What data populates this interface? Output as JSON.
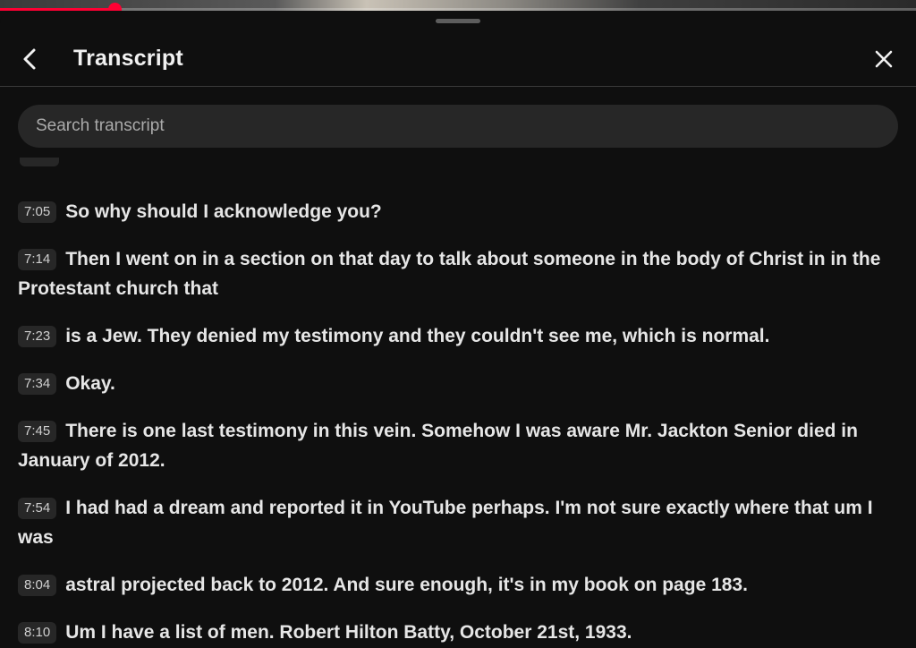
{
  "video": {
    "progress_fraction": 0.125,
    "accent_color": "#ff0033"
  },
  "panel": {
    "title": "Transcript",
    "back_icon": "chevron-left-icon",
    "close_icon": "close-icon"
  },
  "search": {
    "placeholder": "Search transcript",
    "value": ""
  },
  "segments": [
    {
      "time": "7:05",
      "text": "So why should I acknowledge you?"
    },
    {
      "time": "7:14",
      "text": "Then I went on in a section on that day to talk about someone in the body of Christ in in the Protestant church that"
    },
    {
      "time": "7:23",
      "text": "is a Jew. They denied my testimony and they couldn't see me, which is normal."
    },
    {
      "time": "7:34",
      "text": "Okay."
    },
    {
      "time": "7:45",
      "text": "There is one last testimony in this vein. Somehow I was aware Mr. Jackton Senior died in January of 2012."
    },
    {
      "time": "7:54",
      "text": "I had had a dream and reported it in YouTube perhaps. I'm not sure exactly where that um I was"
    },
    {
      "time": "8:04",
      "text": "astral projected back to 2012. And sure enough, it's in my book on page 183."
    },
    {
      "time": "8:10",
      "text": "Um I have a list of men. Robert Hilton Batty, October 21st, 1933."
    }
  ]
}
